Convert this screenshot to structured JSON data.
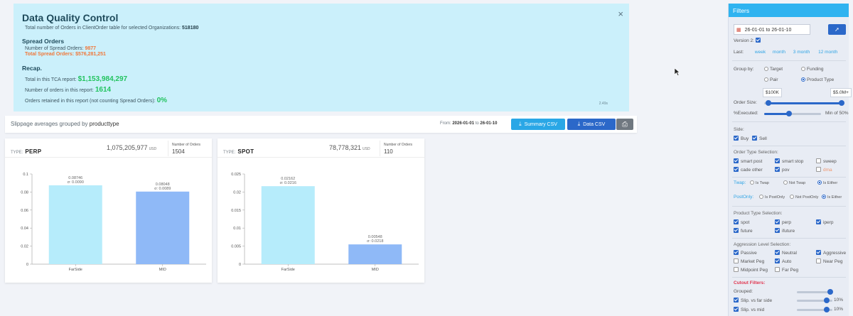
{
  "dq": {
    "title": "Data Quality Control",
    "total_orders_label": "Total number of Orders in ClientOrder table for selected Organizations:",
    "total_orders_value": "518180",
    "spread_title": "Spread Orders",
    "spread_count_label": "Number of Spread Orders:",
    "spread_count_value": "9877",
    "spread_total_label": "Total Spread Orders:",
    "spread_total_value": "$576,281,251",
    "recap_title": "Recap.",
    "tca_label": "Total in this TCA report:",
    "tca_value": "$1,153,984,297",
    "orders_label": "Number of orders in this report:",
    "orders_value": "1614",
    "retained_label": "Orders retained in this report (not counting Spread Orders):",
    "retained_value": "0%",
    "elapsed": "2.49s",
    "close_icon": "×"
  },
  "bar": {
    "prefix": "Slippage averages grouped by",
    "group": "producttype",
    "from_label": "From:",
    "from_value": "2026-01-01",
    "to_label": "to",
    "to_value": "26-01-10",
    "summary_csv": "Summary CSV",
    "data_csv": "Data CSV",
    "download_icon": "⤓",
    "print_icon": "⎙"
  },
  "cards": [
    {
      "type_label": "TYPE:",
      "type": "PERP",
      "total": "1,075,205,977",
      "unit": "USD",
      "orders_label": "Number of Orders",
      "orders": "1504"
    },
    {
      "type_label": "TYPE:",
      "type": "SPOT",
      "total": "78,778,321",
      "unit": "USD",
      "orders_label": "Number of Orders",
      "orders": "110"
    }
  ],
  "chart_data": [
    {
      "type": "bar",
      "categories": [
        "FarSide",
        "MID"
      ],
      "values": [
        0.08746,
        0.08048
      ],
      "sigma": [
        "σ: 0.0090",
        "σ: 0.0089"
      ],
      "value_labels": [
        "0.08746",
        "0.08048"
      ],
      "yticks": [
        0,
        0.02,
        0.04,
        0.06,
        0.08,
        0.1
      ],
      "ytick_labels": [
        "0",
        "0.02",
        "0.04",
        "0.06",
        "0.08",
        "0.1"
      ],
      "ylim": [
        0,
        0.1
      ],
      "colors": [
        "#b6ecfb",
        "#8fb9f7"
      ],
      "grid": false
    },
    {
      "type": "bar",
      "categories": [
        "FarSide",
        "MID"
      ],
      "values": [
        0.02162,
        0.00548
      ],
      "sigma": [
        "σ: 0.0216",
        "σ: 0.0218"
      ],
      "value_labels": [
        "0.02162",
        "0.00548"
      ],
      "yticks": [
        0,
        0.005,
        0.01,
        0.015,
        0.02,
        0.025
      ],
      "ytick_labels": [
        "0",
        "0.005",
        "0.01",
        "0.015",
        "0.02",
        "0.025"
      ],
      "ylim": [
        0,
        0.025
      ],
      "colors": [
        "#b6ecfb",
        "#8fb9f7"
      ],
      "grid": false
    }
  ],
  "filters": {
    "title": "Filters",
    "date_range": "26-01-01 to 26-01-10",
    "calendar_icon": "▦",
    "apply_icon": "➚",
    "version_label": "Version 2:",
    "last_label": "Last:",
    "last_options": [
      "week",
      "month",
      "3 month",
      "12 month"
    ],
    "group_by_label": "Group by:",
    "group_options": [
      "Target",
      "Funding",
      "Pair",
      "Product Type"
    ],
    "order_size_label": "Order Size:",
    "order_size_min": "$100K",
    "order_size_max": "$5.0M+",
    "executed_label": "%Executed:",
    "executed_value": "Min of 50%",
    "side_label": "Side:",
    "side_options": [
      "Buy",
      "Sell"
    ],
    "order_type_label": "Order Type Selection:",
    "order_types": [
      "smart post",
      "smart stop",
      "sweep",
      "cade other",
      "pov",
      "dma"
    ],
    "twap_label": "Twap:",
    "twap_options": [
      "Is Twap",
      "Not Twap",
      "Is Either"
    ],
    "postonly_label": "PostOnly:",
    "postonly_options": [
      "Is PostOnly",
      "Not PostOnly",
      "Is Either"
    ],
    "product_type_label": "Product Type Selection:",
    "product_types": [
      "spot",
      "perp",
      "iperp",
      "future",
      "ifuture"
    ],
    "aggression_label": "Aggression Level Selection:",
    "aggression_levels": [
      "Passive",
      "Neutral",
      "Aggressive",
      "Market Peg",
      "Auto",
      "Near Peg",
      "Midpoint Peg",
      "Far Peg"
    ],
    "cutout_label": "Cutout Filters:",
    "grouped_label": "Grouped:",
    "slip_far_label": "Slip. vs far side",
    "slip_far_value": "10%",
    "slip_mid_label": "Slip. vs mid",
    "slip_mid_value": "10%"
  }
}
